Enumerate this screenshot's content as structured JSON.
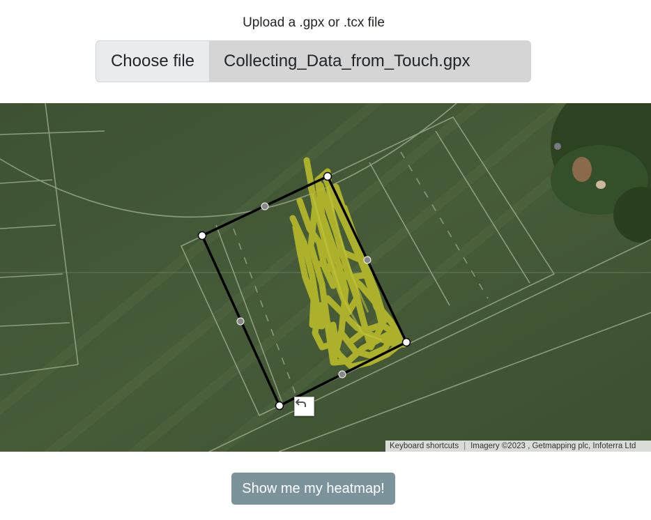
{
  "upload": {
    "label": "Upload a .gpx or .tcx file",
    "button_label": "Choose file",
    "file_name": "Collecting_Data_from_Touch.gpx"
  },
  "map": {
    "keyboard_shortcuts": "Keyboard shortcuts",
    "imagery_credit": "Imagery ©2023 , Getmapping plc, Infoterra Ltd",
    "undo_icon": "undo-icon",
    "track_color": "#b5b82a",
    "polygon_color": "#000000"
  },
  "actions": {
    "heatmap_label": "Show me my heatmap!"
  }
}
